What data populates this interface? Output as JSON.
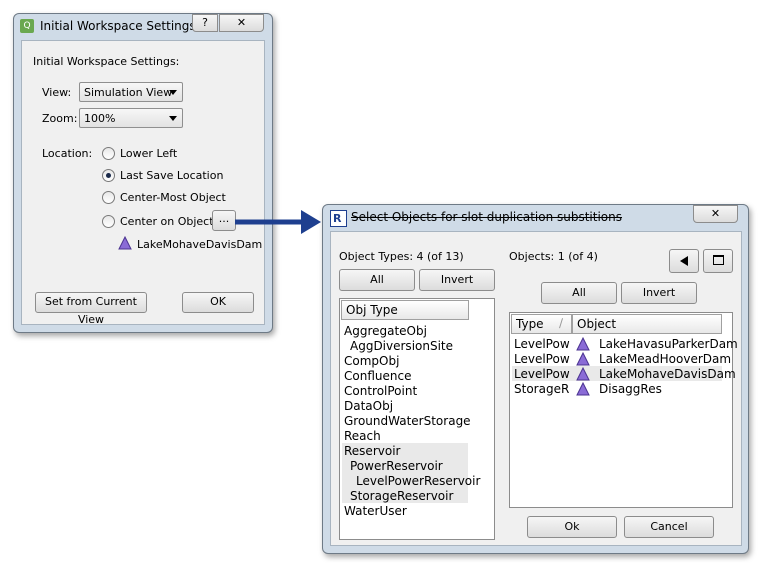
{
  "dialog1": {
    "title": "Initial Workspace Settings...",
    "help_label": "?",
    "close_label": "✕",
    "heading": "Initial Workspace Settings:",
    "view_label": "View:",
    "view_value": "Simulation View",
    "zoom_label": "Zoom:",
    "zoom_value": "100%",
    "location_label": "Location:",
    "options": [
      {
        "label": "Lower Left",
        "selected": false
      },
      {
        "label": "Last Save Location",
        "selected": true
      },
      {
        "label": "Center-Most Object",
        "selected": false
      },
      {
        "label": "Center on Object",
        "selected": false
      }
    ],
    "browse_label": "...",
    "object_name": "LakeMohaveDavisDam",
    "set_current_label": "Set from Current View",
    "ok_label": "OK"
  },
  "dialog2": {
    "title": "Select Objects for slot duplication substitions",
    "close_label": "✕",
    "object_types_label": "Object Types: 4 (of 13)",
    "objects_label": "Objects: 1 (of 4)",
    "all_label": "All",
    "invert_label": "Invert",
    "types_header": "Obj Type",
    "types": [
      {
        "label": "AggregateObj",
        "indent": 0,
        "sel": false
      },
      {
        "label": "AggDiversionSite",
        "indent": 1,
        "sel": false
      },
      {
        "label": "CompObj",
        "indent": 0,
        "sel": false
      },
      {
        "label": "Confluence",
        "indent": 0,
        "sel": false
      },
      {
        "label": "ControlPoint",
        "indent": 0,
        "sel": false
      },
      {
        "label": "DataObj",
        "indent": 0,
        "sel": false
      },
      {
        "label": "GroundWaterStorage",
        "indent": 0,
        "sel": false
      },
      {
        "label": "Reach",
        "indent": 0,
        "sel": false
      },
      {
        "label": "Reservoir",
        "indent": 0,
        "sel": true
      },
      {
        "label": "PowerReservoir",
        "indent": 1,
        "sel": true
      },
      {
        "label": "LevelPowerReservoir",
        "indent": 2,
        "sel": true
      },
      {
        "label": "StorageReservoir",
        "indent": 1,
        "sel": true
      },
      {
        "label": "WaterUser",
        "indent": 0,
        "sel": false
      }
    ],
    "col_type": "Type",
    "col_object": "Object",
    "objects": [
      {
        "type": "LevelPow",
        "name": "LakeHavasuParkerDam",
        "sel": false
      },
      {
        "type": "LevelPow",
        "name": "LakeMeadHooverDam",
        "sel": false
      },
      {
        "type": "LevelPow",
        "name": "LakeMohaveDavisDam",
        "sel": true
      },
      {
        "type": "StorageR",
        "name": "DisaggRes",
        "sel": false
      }
    ],
    "ok_label": "Ok",
    "cancel_label": "Cancel"
  },
  "colors": {
    "frame": "#cfdbe7",
    "arrow": "#1e3f8f",
    "icon_purple": "#8a6bd6",
    "selection": "#e9e9e9"
  }
}
